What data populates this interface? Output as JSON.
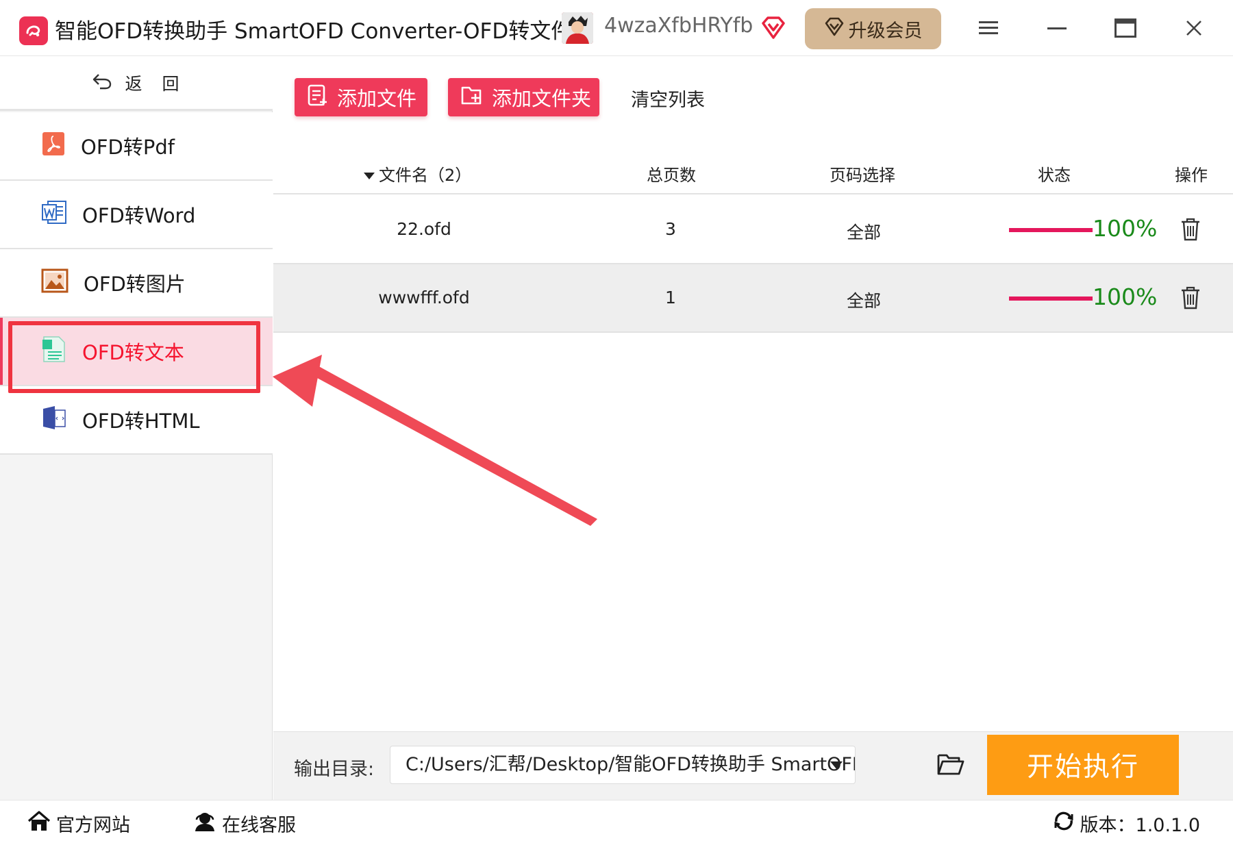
{
  "titlebar": {
    "title": "智能OFD转换助手 SmartOFD Converter-OFD转文件",
    "username": "4wzaXfbHRYfb",
    "upgrade_label": "升级会员",
    "accent": "#ec3154"
  },
  "sidebar": {
    "back_label": "返　回",
    "items": [
      {
        "label": "OFD转Pdf",
        "icon": "pdf-icon"
      },
      {
        "label": "OFD转Word",
        "icon": "word-icon"
      },
      {
        "label": "OFD转图片",
        "icon": "image-icon"
      },
      {
        "label": "OFD转文本",
        "icon": "text-file-icon",
        "active": true
      },
      {
        "label": "OFD转HTML",
        "icon": "html-icon"
      }
    ]
  },
  "toolbar": {
    "add_file_label": "添加文件",
    "add_folder_label": "添加文件夹",
    "clear_list_label": "清空列表"
  },
  "table": {
    "headers": {
      "filename": "文件名（2）",
      "pages": "总页数",
      "page_select": "页码选择",
      "status": "状态",
      "action": "操作"
    },
    "rows": [
      {
        "filename": "22.ofd",
        "pages": "3",
        "page_select": "全部",
        "progress": 1.0,
        "percent": "100%"
      },
      {
        "filename": "wwwfff.ofd",
        "pages": "1",
        "page_select": "全部",
        "progress": 1.0,
        "percent": "100%"
      }
    ]
  },
  "output": {
    "label": "输出目录:",
    "path": "C:/Users/汇帮/Desktop/智能OFD转换助手 SmartOFD",
    "start_label": "开始执行"
  },
  "footer": {
    "website_label": "官方网站",
    "support_label": "在线客服",
    "version_label": "版本：1.0.1.0"
  },
  "colors": {
    "brand_red": "#ef3a5a",
    "active_bg": "#fadbe3",
    "progress": "#e4175c",
    "percent_green": "#1a8a1a",
    "start_orange": "#fe9c13",
    "upgrade_gold": "#d5b895",
    "annotation_red": "#ef3440"
  }
}
